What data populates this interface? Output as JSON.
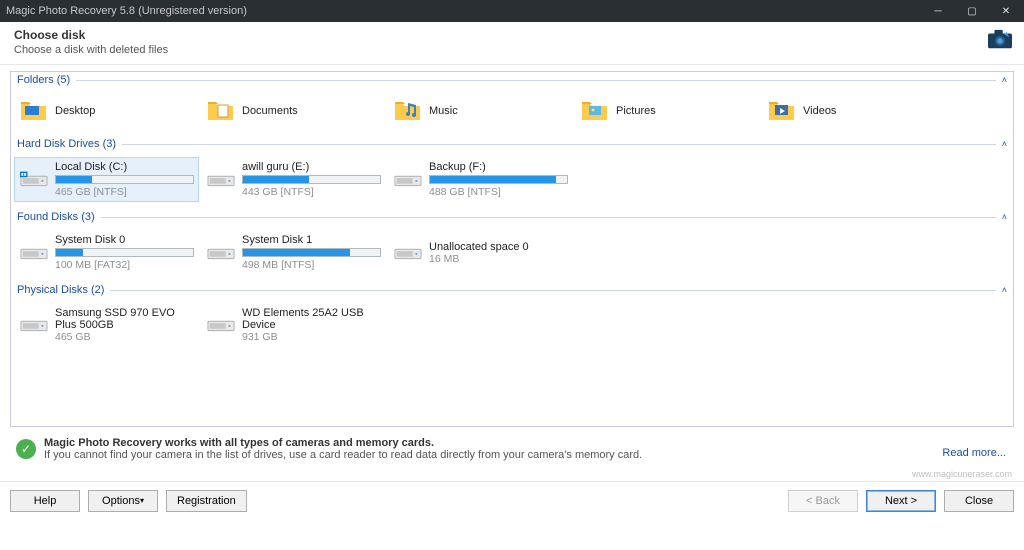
{
  "title": "Magic Photo Recovery 5.8 (Unregistered version)",
  "header": {
    "heading": "Choose disk",
    "sub": "Choose a disk with deleted files"
  },
  "sections": {
    "folders_label": "Folders (5)",
    "hdd_label": "Hard Disk Drives (3)",
    "found_label": "Found Disks (3)",
    "phys_label": "Physical Disks (2)"
  },
  "folders": [
    {
      "name": "Desktop",
      "overlay": "desktop"
    },
    {
      "name": "Documents",
      "overlay": "documents"
    },
    {
      "name": "Music",
      "overlay": "music"
    },
    {
      "name": "Pictures",
      "overlay": "pictures"
    },
    {
      "name": "Videos",
      "overlay": "videos"
    }
  ],
  "hdd": [
    {
      "name": "Local Disk (C:)",
      "sub": "465 GB [NTFS]",
      "fill": 26,
      "selected": true,
      "badge": true
    },
    {
      "name": "awill guru (E:)",
      "sub": "443 GB [NTFS]",
      "fill": 48
    },
    {
      "name": "Backup (F:)",
      "sub": "488 GB [NTFS]",
      "fill": 92
    }
  ],
  "found": [
    {
      "name": "System Disk 0",
      "sub": "100 MB [FAT32]",
      "fill": 20
    },
    {
      "name": "System Disk 1",
      "sub": "498 MB [NTFS]",
      "fill": 78
    },
    {
      "name": "Unallocated space 0",
      "sub": "16 MB",
      "nobar": true
    }
  ],
  "phys": [
    {
      "name": "Samsung SSD 970 EVO Plus 500GB",
      "sub": "465 GB"
    },
    {
      "name": "WD Elements 25A2 USB Device",
      "sub": "931 GB"
    }
  ],
  "note": {
    "line1": "Magic Photo Recovery works with all types of cameras and memory cards.",
    "line2": "If you cannot find your camera in the list of drives, use a card reader to read data directly from your camera's memory card.",
    "readmore": "Read more..."
  },
  "watermark": "www.magicuneraser.com",
  "buttons": {
    "help": "Help",
    "options": "Options",
    "registration": "Registration",
    "back": "< Back",
    "next": "Next >",
    "close": "Close"
  }
}
